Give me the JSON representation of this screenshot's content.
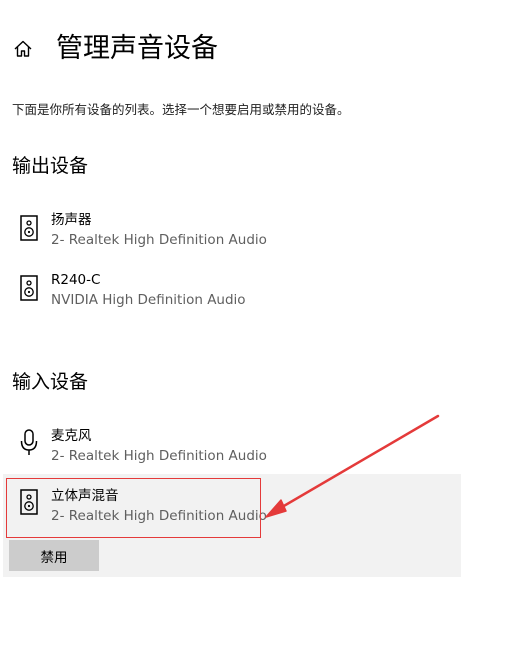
{
  "header": {
    "title": "管理声音设备",
    "home_icon": "home-icon"
  },
  "description": "下面是你所有设备的列表。选择一个想要启用或禁用的设备。",
  "output_section": {
    "title": "输出设备",
    "devices": [
      {
        "name": "扬声器",
        "driver": "2- Realtek High Definition Audio",
        "icon": "speaker-icon"
      },
      {
        "name": "R240-C",
        "driver": "NVIDIA High Definition Audio",
        "icon": "speaker-icon"
      }
    ]
  },
  "input_section": {
    "title": "输入设备",
    "devices": [
      {
        "name": "麦克风",
        "driver": "2- Realtek High Definition Audio",
        "icon": "microphone-icon"
      },
      {
        "name": "立体声混音",
        "driver": "2- Realtek High Definition Audio",
        "icon": "speaker-icon",
        "selected": true
      }
    ]
  },
  "selected_device": {
    "disable_button_label": "禁用"
  },
  "colors": {
    "selection_background": "#f2f2f2",
    "highlight_border": "#e43a3a",
    "button_background": "#cccccc",
    "secondary_text": "#5f5f5f"
  }
}
